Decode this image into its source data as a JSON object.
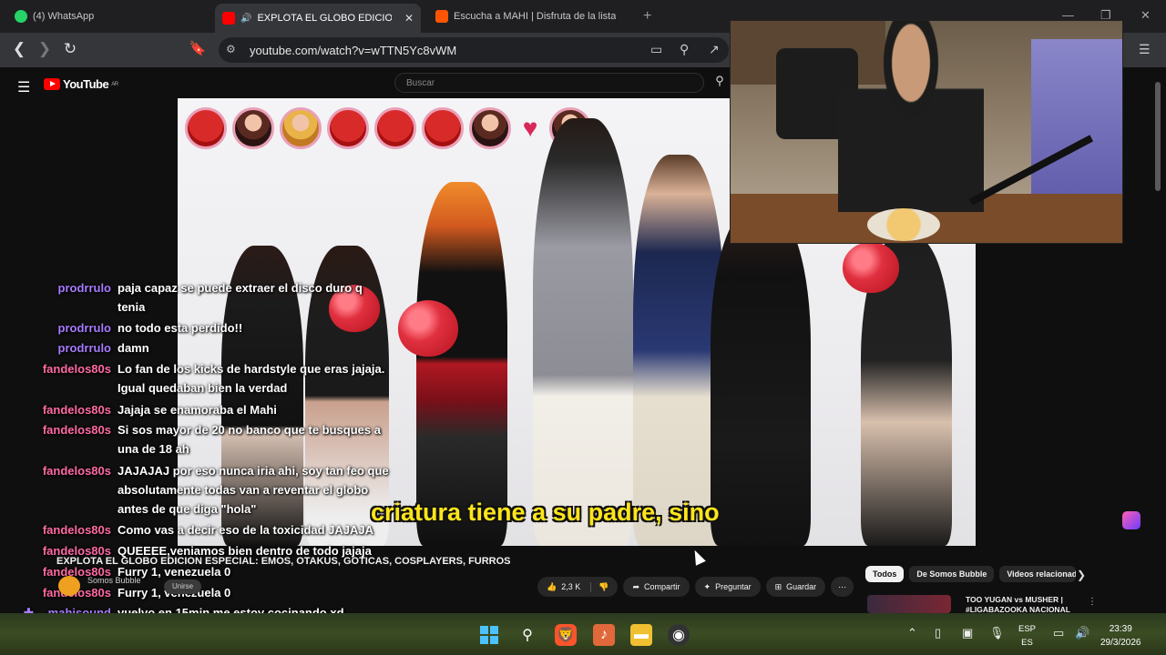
{
  "tabs": [
    {
      "title": "(4) WhatsApp",
      "color": "#25d366"
    },
    {
      "title": "EXPLOTA EL GLOBO EDICION",
      "color": "#ff0000",
      "active": true
    },
    {
      "title": "Escucha a MAHI | Disfruta de la lista",
      "color": "#ff5500"
    }
  ],
  "window_controls": {
    "minimize": "—",
    "maximize": "❐",
    "close": "✕"
  },
  "omnibox": {
    "url": "youtube.com/watch?v=wTTN5Yc8vWM"
  },
  "youtube": {
    "logo": "YouTube",
    "logo_region": "AR",
    "search_placeholder": "Buscar"
  },
  "video": {
    "subtitle": "criatura tiene a su padre, sino",
    "title": "EXPLOTA EL GLOBO EDICION ESPECIAL: EMOS, OTAKUS, GOTICAS, COSPLAYERS, FURROS",
    "channel": "Somos Bubble",
    "join_label": "Unirse",
    "likes": "2,3 K",
    "share_label": "Compartir",
    "ask_label": "Preguntar",
    "save_label": "Guardar"
  },
  "chat": [
    {
      "user": "prodrrulo",
      "msg": "paja capaz se puede extraer el disco duro q tenia",
      "color": "purple"
    },
    {
      "user": "prodrrulo",
      "msg": "no todo esta perdido!!",
      "color": "purple"
    },
    {
      "user": "prodrrulo",
      "msg": "damn",
      "color": "purple"
    },
    {
      "user": "fandelos80s",
      "msg": "Lo fan de los kicks de hardstyle que eras jajaja. Igual quedaban bien la verdad",
      "color": "pink"
    },
    {
      "user": "fandelos80s",
      "msg": "Jajaja se enamoraba el Mahi",
      "color": "pink"
    },
    {
      "user": "fandelos80s",
      "msg": "Si sos mayor de 20 no banco que te busques a una de 18 ah",
      "color": "pink"
    },
    {
      "user": "fandelos80s",
      "msg": "JAJAJAJ por eso nunca iria ahi, soy tan feo que absolutamente todas van a reventar el globo antes de que diga \"hola\"",
      "color": "pink"
    },
    {
      "user": "fandelos80s",
      "msg": "Como vas a decir eso de la toxicidad JAJAJA",
      "color": "pink"
    },
    {
      "user": "fandelos80s",
      "msg": "QUEEEE,veniamos bien dentro de todo jajaja",
      "color": "pink"
    },
    {
      "user": "fandelos80s",
      "msg": "Furry 1, venezuela 0",
      "color": "pink"
    },
    {
      "user": "fandelos80s",
      "msg": "Furry 1, venezuela 0",
      "color": "pink"
    },
    {
      "user": "mahisound",
      "msg": "vuelvo en 15min me estoy cocinando xd",
      "color": "purple"
    }
  ],
  "chips": [
    "Todos",
    "De Somos Bubble",
    "Videos relacionados"
  ],
  "related": {
    "title": "TOO YUGAN vs MUSHER | #LIGABAZOOKA NACIONAL"
  },
  "taskbar": {
    "lang_top": "ESP",
    "lang_bottom": "ES",
    "time": "23:39",
    "date": "29/3/2026"
  }
}
